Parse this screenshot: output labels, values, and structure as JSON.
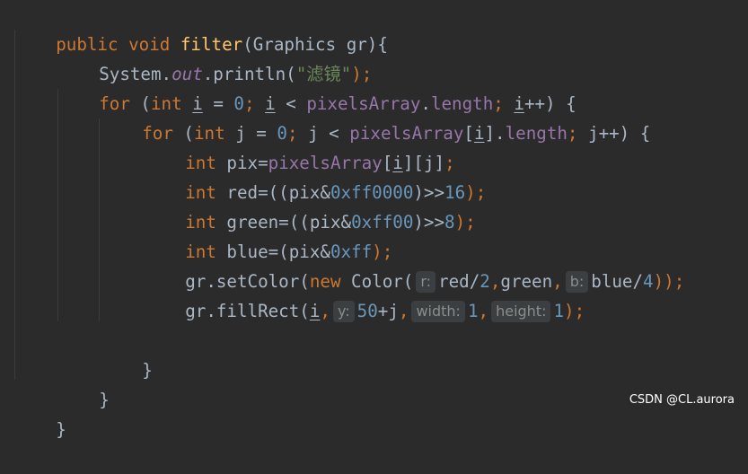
{
  "code": {
    "line1": {
      "kw1": "public",
      "kw2": "void",
      "name": "filter",
      "params": "(Graphics gr){"
    },
    "line2": {
      "obj": "System.",
      "field": "out",
      "call": ".println(",
      "str": "\"滤镜\"",
      "end": ");"
    },
    "line3": {
      "kw": "for",
      "p1": " (",
      "type": "int",
      "sp": " ",
      "var1": "i",
      "eq": " = ",
      "zero": "0",
      "semi1": "; ",
      "var2": "i",
      "lt": " < ",
      "arr": "pixelsArray",
      "dot": ".",
      "len": "length",
      "semi2": "; ",
      "var3": "i",
      "inc": "++) {"
    },
    "line4": {
      "kw": "for",
      "p1": " (",
      "type": "int",
      "decl": " j = ",
      "zero": "0",
      "semi1": "; ",
      "j1": "j < ",
      "arr": "pixelsArray",
      "b1": "[",
      "idx": "i",
      "b2": "].",
      "len": "length",
      "semi2": "; ",
      "inc": "j++) {"
    },
    "line5": {
      "type": "int",
      "decl": " pix=",
      "arr": "pixelsArray",
      "b1": "[",
      "idx": "i",
      "rest": "][j]",
      "semi": ";"
    },
    "line6": {
      "type": "int",
      "decl": " red=((pix&",
      "hex": "0xff0000",
      "shift": ")>>",
      "num": "16",
      "end": ");"
    },
    "line7": {
      "type": "int",
      "decl": " green=((pix&",
      "hex": "0xff00",
      "shift": ")>>",
      "num": "8",
      "end": ");"
    },
    "line8": {
      "type": "int",
      "decl": " blue=(pix&",
      "hex": "0xff",
      "end": ");"
    },
    "line9": {
      "obj": "gr.setColor(",
      "kw": "new",
      "cls": " Color(",
      "hint_r": "r:",
      "red": "red/",
      "n2": "2",
      "comma1": ",",
      "green": "green",
      "comma2": ",",
      "hint_b": "b:",
      "blue": "blue/",
      "n4": "4",
      "end": "));"
    },
    "line10": {
      "obj": "gr.fillRect(",
      "var": "i",
      "comma1": ",",
      "hint_y": "y:",
      "n50": "50",
      "plusj": "+j",
      "comma2": ",",
      "hint_w": "width:",
      "n1a": "1",
      "comma3": ",",
      "hint_h": "height:",
      "n1b": "1",
      "end": ");"
    },
    "line12": {
      "brace": "}"
    },
    "line13": {
      "brace": "}"
    },
    "line14": {
      "brace": "}"
    }
  },
  "watermark": "CSDN @CL.aurora",
  "colors": {
    "background": "#2b2b2b",
    "keyword": "#cc7832",
    "function": "#ffc66d",
    "field": "#9876aa",
    "number": "#6897bb",
    "string": "#6a8759",
    "text": "#a9b7c6",
    "hint_background": "#3b3f41",
    "hint_text": "#8c8c8c"
  }
}
